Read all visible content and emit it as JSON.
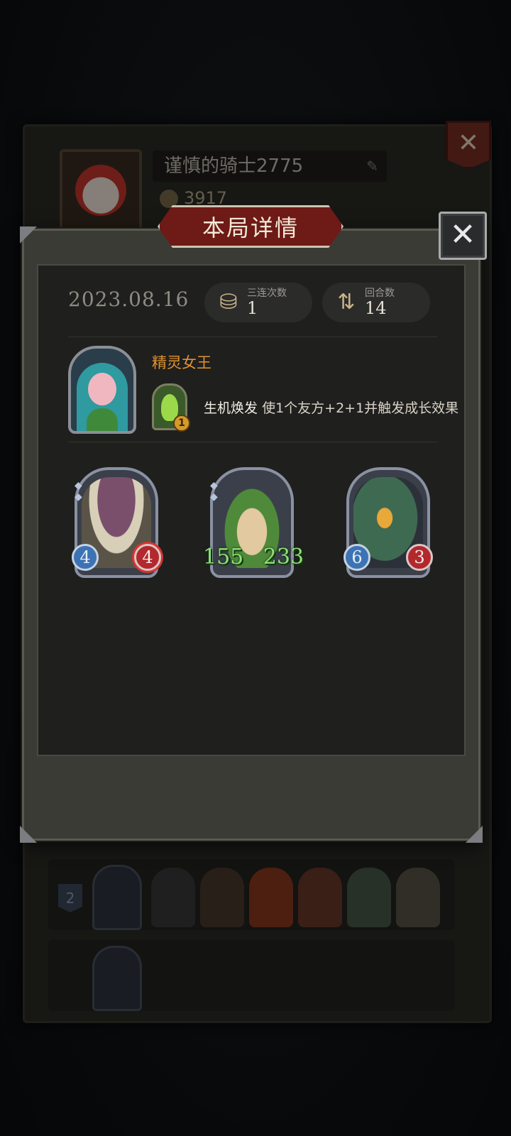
{
  "background_profile": {
    "player_name": "谨慎的骑士2775",
    "coins": "3917",
    "rows": [
      {
        "rank": "2"
      },
      {
        "rank": ""
      }
    ]
  },
  "modal": {
    "title": "本局详情",
    "close_label": "✕",
    "date": "2023.08.16",
    "stats": [
      {
        "label": "三连次数",
        "value": "1",
        "icon": "triple-merge-icon"
      },
      {
        "label": "回合数",
        "value": "14",
        "icon": "turns-icon"
      }
    ],
    "hero": {
      "name": "精灵女王",
      "skill_level": "1",
      "skill_name": "生机焕发",
      "skill_desc": "使1个友方+2+1并触发成长效果"
    },
    "units": [
      {
        "name": "mushroom",
        "attack": "4",
        "health": "4",
        "color": "#6b4a5c"
      },
      {
        "name": "sprout",
        "attack": "155",
        "health": "233",
        "color": "#4f8a3a"
      },
      {
        "name": "parrot",
        "attack": "6",
        "health": "3",
        "color": "#3f6a52"
      }
    ]
  },
  "colors": {
    "title_plate": "#6e1a17",
    "hero_name": "#e0932f",
    "big_stat": "#8fe07a"
  }
}
